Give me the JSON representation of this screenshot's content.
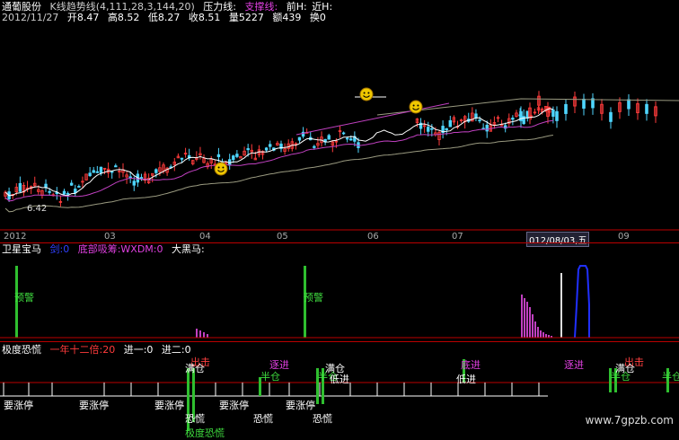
{
  "header1": {
    "name": "通葡股份",
    "indicator": "K线趋势线(4,111,28,3,144,20)",
    "pressure": "压力线:",
    "support": "支撑线:",
    "prev": "前H:",
    "recent": "近H:"
  },
  "header2": {
    "date": "2012/11/27",
    "open": "开8.47",
    "high": "高8.52",
    "low": "低8.27",
    "close": "收8.51",
    "vol": "量5227",
    "amount": "额439",
    "turnover": "换0"
  },
  "price_low_label": "6.42",
  "months": [
    "2012",
    "03",
    "04",
    "05",
    "06",
    "07",
    "012/08/03,五",
    "09"
  ],
  "panel2": {
    "title": "卫星宝马",
    "v1": "剑:0",
    "v2": "底部吸筹:WXDM:0",
    "v3": "大黑马:",
    "alert": "预警",
    "alert2": "预警"
  },
  "panel3": {
    "title": "极度恐慌",
    "t1": "一年十二倍:20",
    "t2": "进一:0",
    "t3": "进二:0"
  },
  "panel3_tags": {
    "chudi": "出击",
    "mancang": "满仓",
    "banchang": "半仓",
    "dijin": "低进",
    "zaojin": "底进",
    "kongh": "恐慌",
    "kongh2": "恐慌",
    "yaozhangting": "要涨停",
    "jidu": "极度恐慌",
    "xijin": "底进",
    "xijin2": "逐进"
  },
  "watermark": "www.7gpzb.com",
  "colors": {
    "up": "#ff3b3b",
    "down": "#4fd6ff",
    "ma1": "#ffffff",
    "ma2": "#c040c0",
    "ma3": "#9a9a80"
  }
}
